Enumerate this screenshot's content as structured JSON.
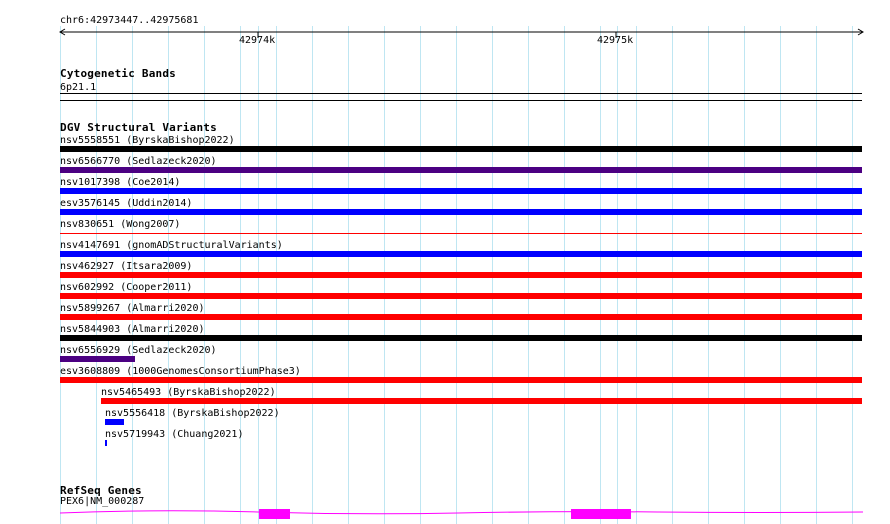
{
  "ruler": {
    "position": "chr6:42973447..42975681",
    "ticks": [
      "42974k",
      "42975k"
    ]
  },
  "cytoband": {
    "title": "Cytogenetic Bands",
    "band": "6p21.1"
  },
  "dgv": {
    "title": "DGV Structural Variants",
    "variants": [
      {
        "label": "nsv5558551 (ByrskaBishop2022)",
        "color": "#000000"
      },
      {
        "label": "nsv6566770 (Sedlazeck2020)",
        "color": "#4b0082"
      },
      {
        "label": "nsv1017398 (Coe2014)",
        "color": "#0000ff"
      },
      {
        "label": "esv3576145 (Uddin2014)",
        "color": "#0000ff"
      },
      {
        "label": "nsv830651 (Wong2007)",
        "color": "#ff0000"
      },
      {
        "label": "nsv4147691 (gnomADStructuralVariants)",
        "color": "#0000ff"
      },
      {
        "label": "nsv462927 (Itsara2009)",
        "color": "#ff0000"
      },
      {
        "label": "nsv602992 (Cooper2011)",
        "color": "#ff0000"
      },
      {
        "label": "nsv5899267 (Almarri2020)",
        "color": "#ff0000"
      },
      {
        "label": "nsv5844903 (Almarri2020)",
        "color": "#000000"
      },
      {
        "label": "nsv6556929 (Sedlazeck2020)",
        "color": "#4b0082"
      },
      {
        "label": "esv3608809 (1000GenomesConsortiumPhase3)",
        "color": "#ff0000"
      },
      {
        "label": "nsv5465493 (ByrskaBishop2022)",
        "color": "#ff0000"
      },
      {
        "label": "nsv5556418 (ByrskaBishop2022)",
        "color": "#0000ff"
      },
      {
        "label": "nsv5719943 (Chuang2021)",
        "color": "#0000ff"
      }
    ]
  },
  "refseq": {
    "title": "RefSeq Genes",
    "gene": "PEX6|NM_000287",
    "color": "#ff00ff"
  }
}
